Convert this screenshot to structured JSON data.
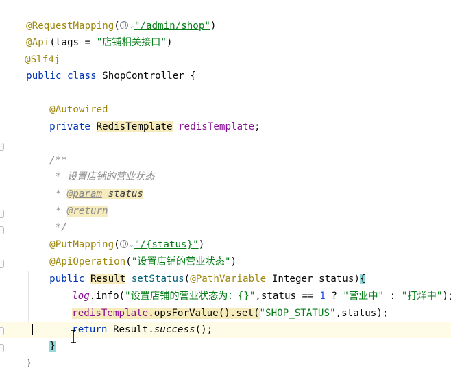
{
  "editor": {
    "language": "java",
    "line1": {
      "annotation": "@RequestMapping",
      "open": "(",
      "path": "\"/admin/shop\"",
      "close": ")"
    },
    "line2": {
      "annotation": "@Api",
      "before": "(tags = ",
      "value": "\"店铺相关接口\"",
      "after": ")"
    },
    "line3": {
      "annotation": "@Slf4j"
    },
    "line4": {
      "kw1": "public",
      "kw2": "class",
      "name": "ShopController {"
    },
    "line6": {
      "annotation": "@Autowired"
    },
    "line7": {
      "kw": "private",
      "type": "RedisTemplate",
      "field": "redisTemplate",
      "end": ";"
    },
    "line9": {
      "text": "/**"
    },
    "line10": {
      "text": " * 设置店铺的营业状态"
    },
    "line11": {
      "prefix": " * ",
      "tag": "@param",
      "param": "status"
    },
    "line12": {
      "prefix": " * ",
      "tag": "@return"
    },
    "line13": {
      "text": " */"
    },
    "line14": {
      "annotation": "@PutMapping",
      "open": "(",
      "path": "\"/{status}\"",
      "close": ")"
    },
    "line15": {
      "annotation": "@ApiOperation",
      "open": "(",
      "value": "\"设置店铺的营业状态\"",
      "close": ")"
    },
    "line16": {
      "kw": "public",
      "type": "Result",
      "method": "setStatus",
      "open": "(",
      "param_ann": "@PathVariable",
      "param_rest": " Integer status)",
      "brace": "{"
    },
    "line17": {
      "log": "log",
      "call": ".info(",
      "fmt": "\"设置店铺的营业状态为：{}\"",
      "mid": ",status == ",
      "num": "1",
      "q": " ? ",
      "s1": "\"营业中\"",
      "colon": " : ",
      "s2": "\"打烊中\"",
      "end": ");"
    },
    "line18": {
      "field": "redisTemplate",
      "call": ".opsForValue().set(",
      "key": "\"SHOP_STATUS\"",
      "end": ",status);"
    },
    "line19": {
      "kw": "return",
      "cls": " Result.",
      "method": "success",
      "end": "();"
    },
    "line20": {
      "brace": "}"
    },
    "line21": {
      "brace": "}"
    }
  }
}
